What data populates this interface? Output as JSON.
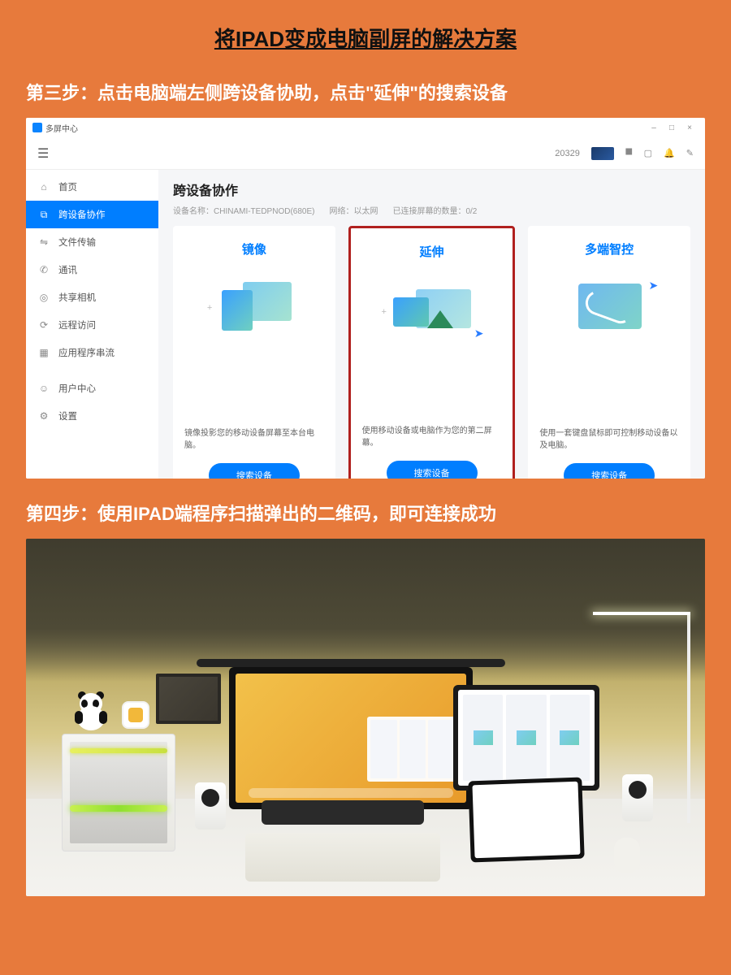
{
  "title": "将IPAD变成电脑副屏的解决方案",
  "step3": "第三步：点击电脑端左侧跨设备协助，点击\"延伸\"的搜索设备",
  "step4": "第四步：使用IPAD端程序扫描弹出的二维码，即可连接成功",
  "app": {
    "name": "多屏中心",
    "window": {
      "min": "–",
      "max": "□",
      "close": "×"
    },
    "topbar": {
      "id": "20329"
    },
    "sidebar": {
      "home": "首页",
      "cross": "跨设备协作",
      "file": "文件传输",
      "comm": "通讯",
      "camera": "共享相机",
      "remote": "远程访问",
      "stream": "应用程序串流",
      "user": "用户中心",
      "settings": "设置"
    },
    "main": {
      "title": "跨设备协作",
      "sub1": "设备名称：CHINAMI-TEDPNOD(680E)",
      "sub2": "网络：以太网",
      "sub3": "已连接屏幕的数量：0/2",
      "card1": {
        "title": "镜像",
        "desc": "镜像投影您的移动设备屏幕至本台电脑。",
        "btn": "搜索设备"
      },
      "card2": {
        "title": "延伸",
        "desc": "使用移动设备或电脑作为您的第二屏幕。",
        "btn": "搜索设备"
      },
      "card3": {
        "title": "多端智控",
        "desc": "使用一套键盘鼠标即可控制移动设备以及电脑。",
        "btn": "搜索设备"
      }
    }
  }
}
